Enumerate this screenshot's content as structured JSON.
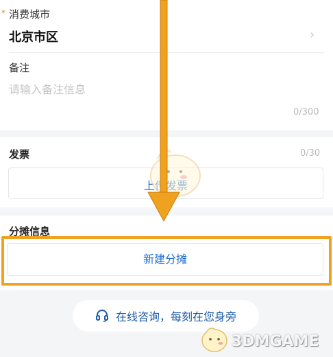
{
  "form": {
    "city_label": "消费城市",
    "city_value": "北京市区",
    "note_label": "备注",
    "note_placeholder": "请输入备注信息",
    "note_count": "0/300",
    "invoice_label": "发票",
    "invoice_count": "0/30",
    "upload_label": "上传发票",
    "split_label": "分摊信息",
    "new_split_button": "新建分摊"
  },
  "consult": {
    "label": "在线咨询，每刻在您身旁"
  },
  "watermark": {
    "text": "3DMGAME"
  },
  "colors": {
    "accent_blue": "#1f6fd1",
    "highlight_orange": "#f0a11e",
    "required_star": "#e08a2a"
  },
  "icons": {
    "city_chevron": "chevron-right-icon",
    "consult": "headset-icon"
  }
}
